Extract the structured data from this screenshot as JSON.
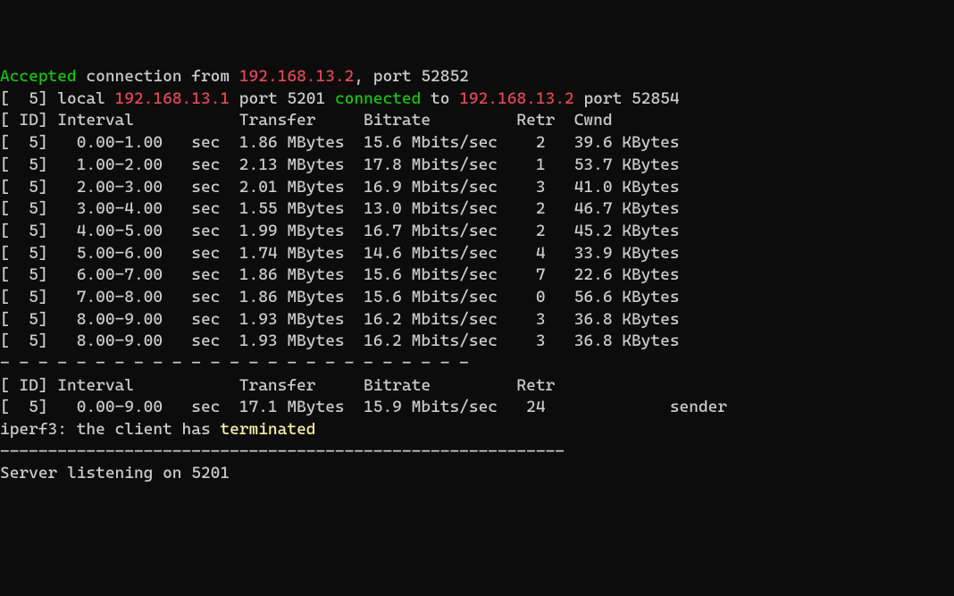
{
  "line1": {
    "w1": "Accepted",
    "p2": " connection from ",
    "ip": "192.168.13.2",
    "p3": ", port 52852"
  },
  "line2": {
    "p1": "[  5] local ",
    "ip1": "192.168.13.1",
    "p2": " port 5201 ",
    "w3": "connected",
    "p3": " to ",
    "ip2": "192.168.13.2",
    "p4": " port 52854"
  },
  "head1": "[ ID] Interval           Transfer     Bitrate         Retr  Cwnd",
  "r0": "[  5]   0.00-1.00   sec  1.86 MBytes  15.6 Mbits/sec    2   39.6 KBytes",
  "r1": "[  5]   1.00-2.00   sec  2.13 MBytes  17.8 Mbits/sec    1   53.7 KBytes",
  "r2": "[  5]   2.00-3.00   sec  2.01 MBytes  16.9 Mbits/sec    3   41.0 KBytes",
  "r3": "[  5]   3.00-4.00   sec  1.55 MBytes  13.0 Mbits/sec    2   46.7 KBytes",
  "r4": "[  5]   4.00-5.00   sec  1.99 MBytes  16.7 Mbits/sec    2   45.2 KBytes",
  "r5": "[  5]   5.00-6.00   sec  1.74 MBytes  14.6 Mbits/sec    4   33.9 KBytes",
  "r6": "[  5]   6.00-7.00   sec  1.86 MBytes  15.6 Mbits/sec    7   22.6 KBytes",
  "r7": "[  5]   7.00-8.00   sec  1.86 MBytes  15.6 Mbits/sec    0   56.6 KBytes",
  "r8": "[  5]   8.00-9.00   sec  1.93 MBytes  16.2 Mbits/sec    3   36.8 KBytes",
  "r9": "[  5]   8.00-9.00   sec  1.93 MBytes  16.2 Mbits/sec    3   36.8 KBytes",
  "dash1": "- - - - - - - - - - - - - - - - - - - - - - - - -",
  "head2": "[ ID] Interval           Transfer     Bitrate         Retr",
  "sum": "[  5]   0.00-9.00   sec  17.1 MBytes  15.9 Mbits/sec   24             sender",
  "term": {
    "p1": "iperf3: the client has ",
    "w": "terminated"
  },
  "dash2": "-----------------------------------------------------------",
  "listen": "Server listening on 5201",
  "chart_data": {
    "type": "table",
    "title": "iperf3 interval results",
    "columns": [
      "ID",
      "Interval_start_s",
      "Interval_end_s",
      "Transfer_MBytes",
      "Bitrate_Mbits_per_s",
      "Retr",
      "Cwnd_KBytes"
    ],
    "rows": [
      [
        5,
        0.0,
        1.0,
        1.86,
        15.6,
        2,
        39.6
      ],
      [
        5,
        1.0,
        2.0,
        2.13,
        17.8,
        1,
        53.7
      ],
      [
        5,
        2.0,
        3.0,
        2.01,
        16.9,
        3,
        41.0
      ],
      [
        5,
        3.0,
        4.0,
        1.55,
        13.0,
        2,
        46.7
      ],
      [
        5,
        4.0,
        5.0,
        1.99,
        16.7,
        2,
        45.2
      ],
      [
        5,
        5.0,
        6.0,
        1.74,
        14.6,
        4,
        33.9
      ],
      [
        5,
        6.0,
        7.0,
        1.86,
        15.6,
        7,
        22.6
      ],
      [
        5,
        7.0,
        8.0,
        1.86,
        15.6,
        0,
        56.6
      ],
      [
        5,
        8.0,
        9.0,
        1.93,
        16.2,
        3,
        36.8
      ],
      [
        5,
        8.0,
        9.0,
        1.93,
        16.2,
        3,
        36.8
      ]
    ],
    "summary": {
      "ID": 5,
      "Interval": "0.00-9.00",
      "Transfer_MBytes": 17.1,
      "Bitrate_Mbits_per_s": 15.9,
      "Retr": 24,
      "role": "sender"
    },
    "connection": {
      "client_ip": "192.168.13.2",
      "client_port_ctrl": 52852,
      "client_port_data": 52854,
      "server_ip": "192.168.13.1",
      "server_port": 5201
    }
  }
}
